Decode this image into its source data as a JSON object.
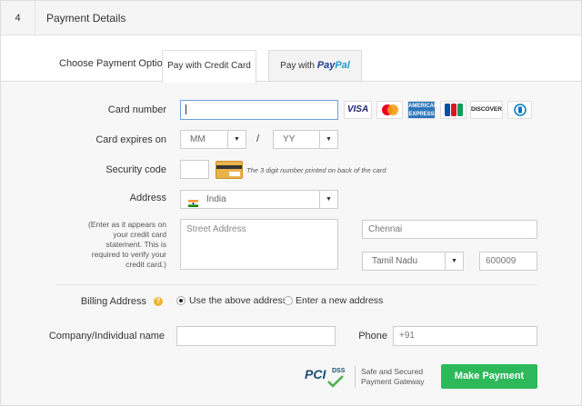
{
  "header": {
    "step": "4",
    "title": "Payment Details"
  },
  "tabs": {
    "choose_label": "Choose Payment Option",
    "credit_card": "Pay with Credit Card",
    "paypal_prefix": "Pay with",
    "paypal_pay": "Pay",
    "paypal_pal": "Pal"
  },
  "card_number": {
    "label": "Card number",
    "value": ""
  },
  "card_brands": [
    "VISA",
    "MC",
    "AMEX",
    "JCB",
    "DISCOVER",
    "DC"
  ],
  "expiry": {
    "label": "Card expires on",
    "month": "MM",
    "separator": "/",
    "year": "YY"
  },
  "security": {
    "label": "Security code",
    "hint": "The 3 digit number printed on back of the card"
  },
  "address": {
    "label": "Address",
    "country": "India",
    "hint": "(Enter as it appears on your credit card statement. This is required to verify your credit card.)",
    "street_placeholder": "Street Address",
    "city": "Chennai",
    "state": "Tamil Nadu",
    "zip": "600009"
  },
  "billing": {
    "label": "Billing Address",
    "help": "?",
    "option_same": "Use the above address",
    "option_new": "Enter a new address"
  },
  "company": {
    "label": "Company/Individual name",
    "value": ""
  },
  "phone": {
    "label": "Phone",
    "value": "+91"
  },
  "footer": {
    "pci": "PCI",
    "dss": "DSS",
    "secure_line1": "Safe and Secured",
    "secure_line2": "Payment Gateway",
    "pay_button": "Make Payment"
  },
  "colors": {
    "accent": "#2db95a",
    "focus_border": "#6aa2d8",
    "paypal_dark": "#1a3b8f",
    "paypal_light": "#1e9bd7"
  }
}
